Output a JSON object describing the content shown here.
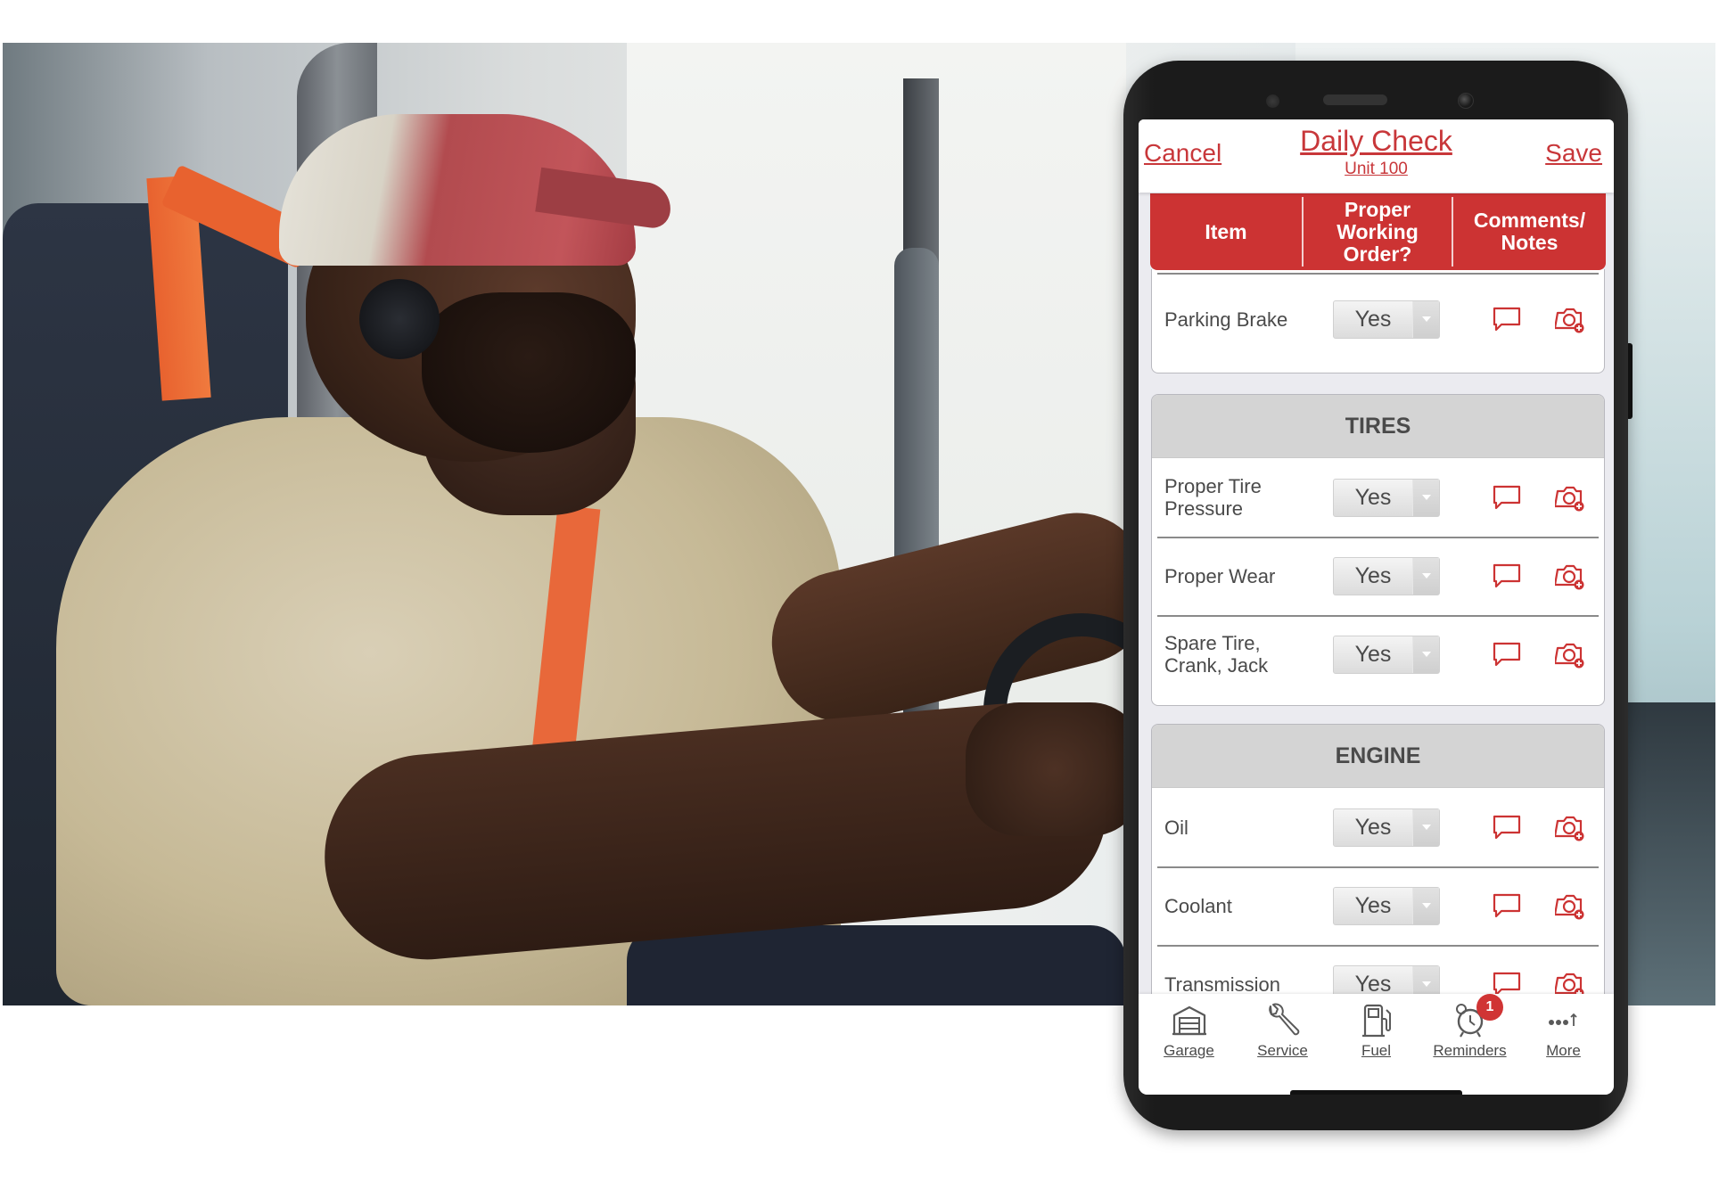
{
  "photo": {
    "description": "Truck driver wearing a red cap and headset, seated in a truck cab with hands on the steering wheel"
  },
  "app": {
    "header": {
      "cancel_label": "Cancel",
      "title": "Daily Check",
      "subtitle": "Unit 100",
      "save_label": "Save"
    },
    "table_header": {
      "columns": [
        "Item",
        "Proper Working Order?",
        "Comments/ Notes"
      ],
      "col1": "Item",
      "col2": "Proper Working Order?",
      "col3": "Comments/ Notes"
    },
    "sections": [
      {
        "title": "",
        "items": [
          {
            "label": "Parking Brake",
            "value": "Yes"
          }
        ]
      },
      {
        "title": "TIRES",
        "items": [
          {
            "label": "Proper Tire Pressure",
            "value": "Yes"
          },
          {
            "label": "Proper Wear",
            "value": "Yes"
          },
          {
            "label": "Spare Tire, Crank, Jack",
            "value": "Yes"
          }
        ]
      },
      {
        "title": "ENGINE",
        "items": [
          {
            "label": "Oil",
            "value": "Yes"
          },
          {
            "label": "Coolant",
            "value": "Yes"
          },
          {
            "label": "Transmission",
            "value": "Yes"
          }
        ]
      }
    ],
    "row_icons": [
      "comment-icon",
      "camera-add-icon"
    ],
    "bottom_nav": [
      {
        "label": "Garage",
        "icon": "garage-icon"
      },
      {
        "label": "Service",
        "icon": "wrench-icon"
      },
      {
        "label": "Fuel",
        "icon": "fuel-pump-icon"
      },
      {
        "label": "Reminders",
        "icon": "alarm-clock-icon",
        "badge": "1"
      },
      {
        "label": "More",
        "icon": "more-icon"
      }
    ],
    "colors": {
      "accent": "#cc3333",
      "text": "#4a4a4a",
      "section_header": "#d4d4d4",
      "background": "#ebebf0"
    }
  }
}
